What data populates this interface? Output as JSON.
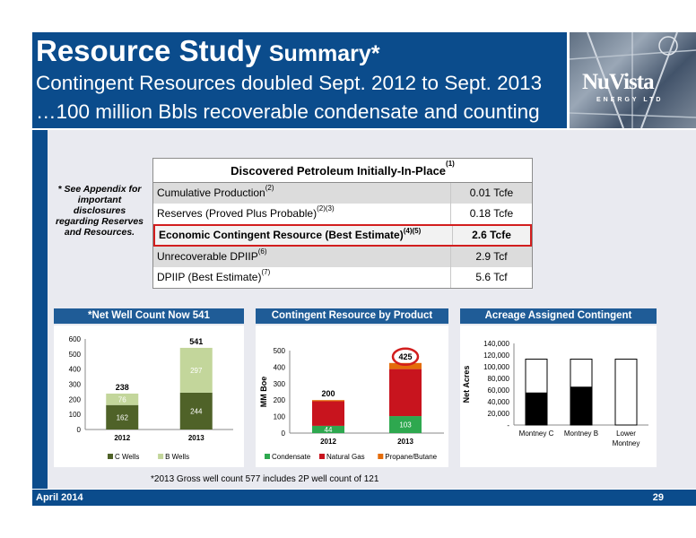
{
  "header": {
    "title_main": "Resource Study",
    "title_sub": "Summary*",
    "subtitle1": "Contingent Resources doubled Sept. 2012 to Sept. 2013",
    "subtitle2": "…100 million Bbls recoverable condensate and counting"
  },
  "logo": {
    "name": "NuVista",
    "tagline": "ENERGY LTD"
  },
  "appendix_note": "* See Appendix for important disclosures regarding Reserves and Resources.",
  "table": {
    "title": "Discovered Petroleum Initially-In-Place",
    "title_sup": "(1)",
    "rows": [
      {
        "label": "Cumulative Production",
        "sup": "(2)",
        "value": "0.01 Tcfe"
      },
      {
        "label": "Reserves (Proved Plus Probable)",
        "sup": "(2)(3)",
        "value": "0.18 Tcfe"
      },
      {
        "label": "Economic Contingent Resource (Best Estimate)",
        "sup": "(4)(5)",
        "value": "2.6 Tcfe"
      },
      {
        "label": "Unrecoverable DPIIP",
        "sup": "(6)",
        "value": "2.9 Tcf"
      },
      {
        "label": "DPIIP (Best Estimate)",
        "sup": "(7)",
        "value": "5.6 Tcf"
      }
    ]
  },
  "panels": {
    "wells": "*Net Well Count Now 541",
    "product": "Contingent Resource by Product",
    "acreage": "Acreage Assigned Contingent Resource"
  },
  "chart_data": [
    {
      "type": "bar",
      "stacked": true,
      "categories": [
        "2012",
        "2013"
      ],
      "series": [
        {
          "name": "C Wells",
          "values": [
            162,
            244
          ],
          "color": "#4f6228"
        },
        {
          "name": "B Wells",
          "values": [
            76,
            297
          ],
          "color": "#c3d69b"
        }
      ],
      "totals": [
        238,
        541
      ],
      "ylim": [
        0,
        600
      ],
      "yticks": [
        0,
        100,
        200,
        300,
        400,
        500,
        600
      ],
      "legend": "bottom"
    },
    {
      "type": "bar",
      "stacked": true,
      "categories": [
        "2012",
        "2013"
      ],
      "series": [
        {
          "name": "Condensate",
          "values": [
            44,
            103
          ],
          "color": "#2ea84f"
        },
        {
          "name": "Natural Gas",
          "values": [
            149,
            285
          ],
          "color": "#c8141e"
        },
        {
          "name": "Propane/Butane",
          "values": [
            7,
            37
          ],
          "color": "#e46c0a"
        }
      ],
      "totals": [
        200,
        425
      ],
      "ylabel": "MM Boe",
      "ylim": [
        0,
        500
      ],
      "yticks": [
        0,
        100,
        200,
        300,
        400,
        500
      ],
      "legend": "bottom"
    },
    {
      "type": "bar",
      "stacked": true,
      "categories": [
        "Montney C",
        "Montney B",
        "Lower Montney"
      ],
      "series": [
        {
          "name": "assigned",
          "values": [
            55000,
            65000,
            0
          ],
          "color": "#000000"
        },
        {
          "name": "remaining",
          "values": [
            58000,
            48000,
            113000
          ],
          "color": "#ffffff"
        }
      ],
      "ylabel": "Net Acres",
      "ylim": [
        0,
        140000
      ],
      "yticks": [
        "-",
        "20,000",
        "40,000",
        "60,000",
        "80,000",
        "100,000",
        "120,000",
        "140,000"
      ],
      "legend": "none"
    }
  ],
  "footnote": "*2013 Gross well count  577 includes 2P well count of 121",
  "footer": {
    "date": "April 2014",
    "page": "29"
  }
}
